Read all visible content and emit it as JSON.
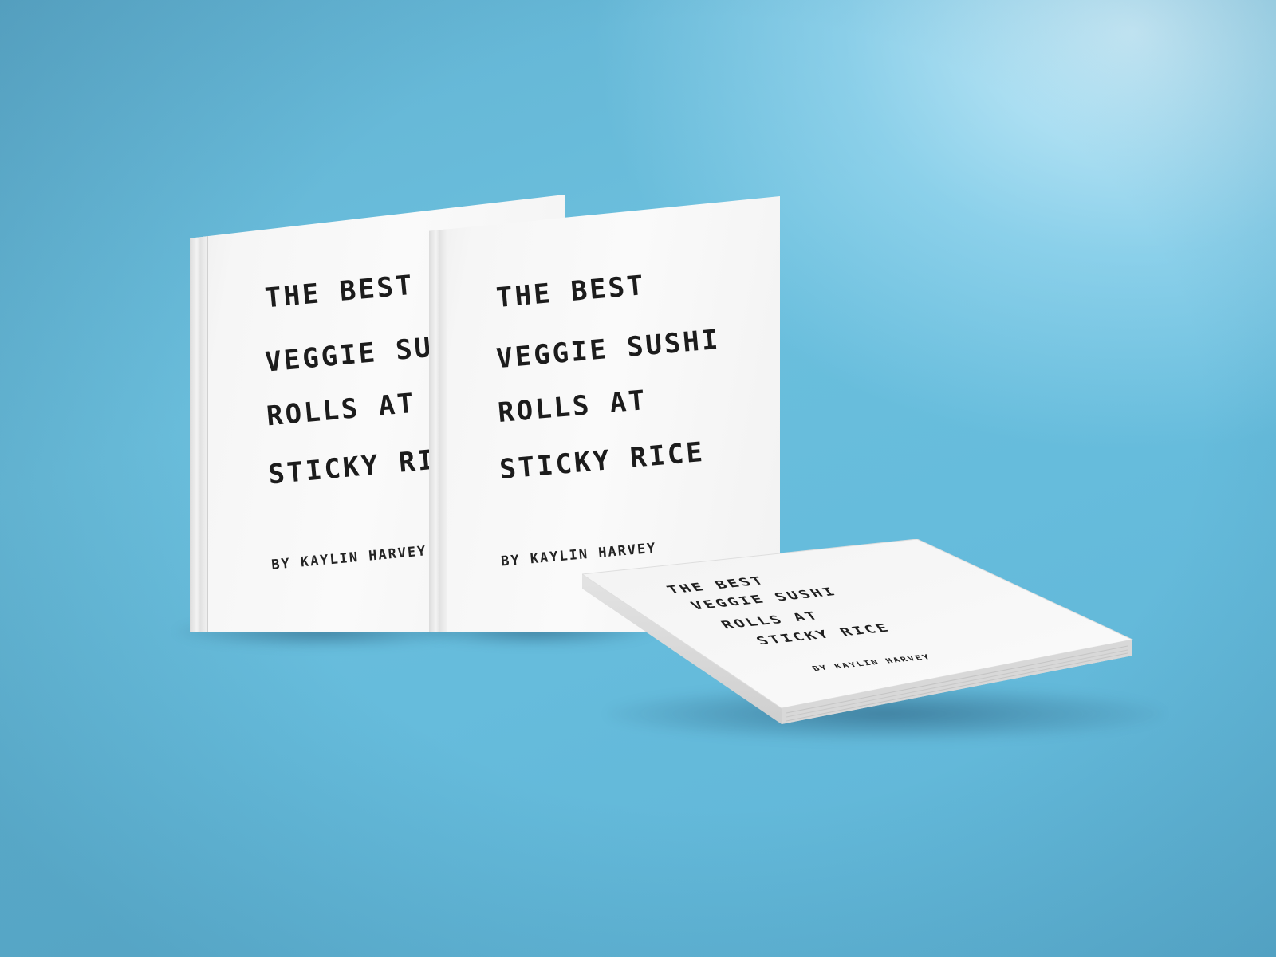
{
  "scene": {
    "background_color": "#66bcdc",
    "highlight_color": "#d9f3ff"
  },
  "book": {
    "title_lines": [
      "The best",
      "veggie sushi",
      "Rolls at",
      "sticky rice"
    ],
    "author": "By Kaylin Harvey",
    "cover_color": "#f5f5f5",
    "text_color": "#1c1c1c"
  }
}
